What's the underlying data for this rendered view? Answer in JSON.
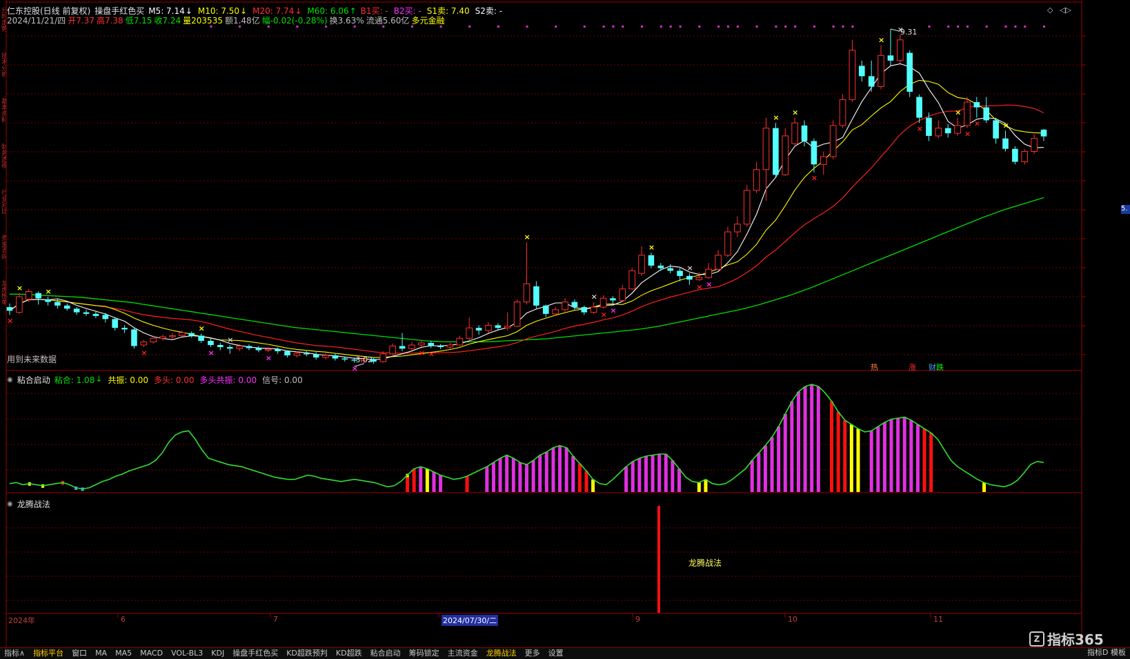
{
  "header": {
    "stock_title": "仁东控股(日线 前复权)",
    "indicator_name": "操盘手红色买",
    "ma": [
      {
        "label": "M5: 7.14",
        "arrow": "↓",
        "color": "#ffffff"
      },
      {
        "label": "M10: 7.50",
        "arrow": "↓",
        "color": "#ffff00"
      },
      {
        "label": "M20: 7.74",
        "arrow": "↓",
        "color": "#ff3030"
      },
      {
        "label": "M60: 6.06",
        "arrow": "↑",
        "color": "#00e000"
      }
    ],
    "signals": [
      {
        "label": "B1买: -",
        "color": "#ff3030"
      },
      {
        "label": "B2买: -",
        "color": "#ff30ff"
      },
      {
        "label": "S1卖: 7.40",
        "color": "#ffff00"
      },
      {
        "label": "S2卖: -",
        "color": "#ffffff"
      }
    ],
    "info": [
      {
        "label": "2024/11/21/四",
        "color": "#c0c0c0"
      },
      {
        "label": "开7.37",
        "color": "#ff3030"
      },
      {
        "label": "高7.38",
        "color": "#ff3030"
      },
      {
        "label": "低7.15",
        "color": "#00e000"
      },
      {
        "label": "收7.24",
        "color": "#00e000"
      },
      {
        "label": "量203535",
        "color": "#ffff00"
      },
      {
        "label": "额1.48亿",
        "color": "#c0c0c0"
      },
      {
        "label": "幅-0.02(-0.28%)",
        "color": "#00e000"
      },
      {
        "label": "换3.63%",
        "color": "#c0c0c0"
      },
      {
        "label": "流通5.60亿",
        "color": "#c0c0c0"
      },
      {
        "label": "多元金融",
        "color": "#ffff00"
      }
    ]
  },
  "main_chart": {
    "future_data_note": "用到未来数据",
    "high_label": "9.31",
    "low_label": "3.02",
    "right_price_badge": "5.",
    "bottom_tags": [
      {
        "label": "热",
        "color": "#ff8040"
      },
      {
        "label": "涨",
        "color": "#ff3030"
      },
      {
        "label": "财",
        "color": "#40a0ff"
      },
      {
        "label": "跌",
        "color": "#00ff00"
      }
    ]
  },
  "panel2": {
    "title": "粘合启动",
    "items": [
      {
        "label": "粘合: 1.08",
        "arrow": "↓",
        "color": "#00e000"
      },
      {
        "label": "共振: 0.00",
        "color": "#ffff00"
      },
      {
        "label": "多头: 0.00",
        "color": "#ff3030"
      },
      {
        "label": "多头共振: 0.00",
        "color": "#ff30ff"
      },
      {
        "label": "信号: 0.00",
        "color": "#c0c0c0"
      }
    ]
  },
  "panel3": {
    "title": "龙腾战法",
    "signal_label": "龙腾战法"
  },
  "time_axis": [
    {
      "label": "2024年",
      "highlight": false
    },
    {
      "label": "6",
      "highlight": false
    },
    {
      "label": "7",
      "highlight": false
    },
    {
      "label": "2024/07/30/二",
      "highlight": true
    },
    {
      "label": "9",
      "highlight": false
    },
    {
      "label": "10",
      "highlight": false
    },
    {
      "label": "11",
      "highlight": false
    }
  ],
  "watermark": "指标365",
  "bottom_tabs": [
    {
      "label": "指标∧",
      "active": false
    },
    {
      "label": "指标平台",
      "active": true
    },
    {
      "label": "窗口",
      "active": false
    },
    {
      "label": "MA",
      "active": false
    },
    {
      "label": "MA5",
      "active": false
    },
    {
      "label": "MACD",
      "active": false
    },
    {
      "label": "VOL-BL3",
      "active": false
    },
    {
      "label": "KDJ",
      "active": false
    },
    {
      "label": "操盘手红色买",
      "active": false
    },
    {
      "label": "KD超跌预判",
      "active": false
    },
    {
      "label": "KD超跌",
      "active": false
    },
    {
      "label": "粘合启动",
      "active": false
    },
    {
      "label": "筹码锁定",
      "active": false
    },
    {
      "label": "主流资金",
      "active": false
    },
    {
      "label": "龙腾战法",
      "active": true
    },
    {
      "label": "更多",
      "active": false
    },
    {
      "label": "设置",
      "active": false
    }
  ],
  "bottom_right": "指标D 模板",
  "left_tabs": [
    "分时走势",
    "技术分析",
    "基本资料",
    "财务透视",
    "行业对比",
    "资金流向",
    "龙虎榜单"
  ],
  "colors": {
    "up": "#ff3030",
    "down": "#54ffff",
    "ma5": "#ffffff",
    "ma10": "#ffff00",
    "ma20": "#ff2020",
    "ma60": "#00e000",
    "grid": "#7a0000",
    "border": "#a00000"
  },
  "chart_data": {
    "type": "candlestick",
    "candles": [
      [
        3.95,
        3.88,
        4.02,
        3.8
      ],
      [
        3.85,
        4.15,
        4.22,
        3.82
      ],
      [
        4.1,
        4.25,
        4.3,
        4.05
      ],
      [
        4.22,
        4.12,
        4.25,
        4.0
      ],
      [
        4.1,
        4.05,
        4.15,
        3.98
      ],
      [
        4.05,
        3.98,
        4.1,
        3.92
      ],
      [
        3.98,
        3.92,
        4.02,
        3.88
      ],
      [
        3.92,
        3.85,
        3.95,
        3.8
      ],
      [
        3.85,
        3.82,
        3.9,
        3.78
      ],
      [
        3.82,
        3.78,
        3.86,
        3.74
      ],
      [
        3.8,
        3.72,
        3.84,
        3.65
      ],
      [
        3.72,
        3.55,
        3.76,
        3.5
      ],
      [
        3.55,
        3.52,
        3.6,
        3.45
      ],
      [
        3.52,
        3.2,
        3.55,
        3.15
      ],
      [
        3.22,
        3.28,
        3.32,
        3.18
      ],
      [
        3.28,
        3.35,
        3.4,
        3.25
      ],
      [
        3.35,
        3.38,
        3.42,
        3.3
      ],
      [
        3.38,
        3.4,
        3.45,
        3.34
      ],
      [
        3.4,
        3.46,
        3.5,
        3.38
      ],
      [
        3.45,
        3.4,
        3.48,
        3.36
      ],
      [
        3.4,
        3.3,
        3.44,
        3.26
      ],
      [
        3.3,
        3.22,
        3.34,
        3.18
      ],
      [
        3.22,
        3.18,
        3.26,
        3.12
      ],
      [
        3.18,
        3.15,
        3.22,
        3.05
      ],
      [
        3.15,
        3.2,
        3.24,
        3.1
      ],
      [
        3.2,
        3.16,
        3.23,
        3.12
      ],
      [
        3.16,
        3.12,
        3.2,
        3.08
      ],
      [
        3.12,
        3.14,
        3.18,
        3.08
      ],
      [
        3.14,
        3.1,
        3.17,
        3.05
      ],
      [
        3.1,
        3.02,
        3.12,
        2.98
      ],
      [
        3.02,
        3.06,
        3.1,
        2.98
      ],
      [
        3.06,
        3.04,
        3.1,
        3.0
      ],
      [
        3.04,
        2.98,
        3.08,
        2.94
      ],
      [
        2.98,
        3.02,
        3.06,
        2.94
      ],
      [
        3.02,
        2.96,
        3.05,
        2.92
      ],
      [
        2.96,
        2.94,
        3.0,
        2.9
      ],
      [
        2.94,
        2.92,
        2.98,
        2.88
      ],
      [
        2.92,
        2.95,
        2.98,
        2.86
      ],
      [
        2.95,
        2.9,
        2.97,
        2.86
      ],
      [
        2.9,
        3.05,
        3.1,
        2.88
      ],
      [
        3.05,
        3.2,
        3.25,
        3.0
      ],
      [
        3.2,
        3.15,
        3.45,
        3.1
      ],
      [
        3.15,
        3.22,
        3.28,
        3.12
      ],
      [
        3.22,
        3.26,
        3.3,
        3.18
      ],
      [
        3.26,
        3.2,
        3.3,
        3.16
      ],
      [
        3.2,
        3.18,
        3.24,
        3.14
      ],
      [
        3.18,
        3.22,
        3.26,
        3.14
      ],
      [
        3.22,
        3.35,
        3.4,
        3.2
      ],
      [
        3.35,
        3.55,
        3.75,
        3.3
      ],
      [
        3.55,
        3.5,
        3.6,
        3.42
      ],
      [
        3.5,
        3.6,
        3.66,
        3.45
      ],
      [
        3.6,
        3.55,
        3.64,
        3.5
      ],
      [
        3.55,
        3.58,
        3.85,
        3.5
      ],
      [
        3.58,
        4.05,
        4.1,
        3.56
      ],
      [
        4.05,
        4.4,
        5.2,
        4.0
      ],
      [
        4.35,
        3.98,
        4.45,
        3.92
      ],
      [
        3.98,
        3.82,
        4.0,
        3.76
      ],
      [
        3.82,
        3.9,
        3.96,
        3.78
      ],
      [
        3.9,
        4.05,
        4.12,
        3.86
      ],
      [
        4.05,
        3.95,
        4.1,
        3.9
      ],
      [
        3.95,
        3.85,
        3.98,
        3.8
      ],
      [
        3.85,
        3.95,
        4.05,
        3.82
      ],
      [
        3.95,
        4.12,
        4.18,
        3.92
      ],
      [
        4.12,
        4.08,
        4.16,
        4.0
      ],
      [
        4.08,
        4.3,
        4.38,
        4.05
      ],
      [
        4.3,
        4.65,
        4.7,
        4.28
      ],
      [
        4.6,
        4.95,
        5.12,
        4.55
      ],
      [
        4.95,
        4.75,
        5.0,
        4.7
      ],
      [
        4.75,
        4.7,
        4.8,
        4.65
      ],
      [
        4.7,
        4.65,
        4.78,
        4.6
      ],
      [
        4.65,
        4.55,
        4.7,
        4.45
      ],
      [
        4.55,
        4.48,
        4.6,
        4.38
      ],
      [
        4.48,
        4.52,
        4.62,
        4.45
      ],
      [
        4.52,
        4.68,
        4.8,
        4.5
      ],
      [
        4.68,
        4.95,
        5.05,
        4.65
      ],
      [
        4.95,
        5.4,
        5.5,
        4.92
      ],
      [
        5.4,
        5.55,
        5.7,
        5.3
      ],
      [
        5.55,
        6.2,
        6.3,
        5.5
      ],
      [
        6.2,
        6.6,
        6.75,
        6.15
      ],
      [
        6.6,
        7.4,
        7.6,
        6.0
      ],
      [
        7.4,
        6.5,
        7.5,
        6.45
      ],
      [
        6.5,
        7.25,
        7.4,
        6.48
      ],
      [
        7.1,
        7.5,
        7.6,
        7.05
      ],
      [
        7.45,
        7.15,
        7.55,
        7.05
      ],
      [
        7.15,
        6.7,
        7.2,
        6.55
      ],
      [
        6.7,
        6.85,
        6.95,
        6.5
      ],
      [
        6.85,
        7.45,
        7.55,
        6.8
      ],
      [
        7.45,
        7.95,
        8.05,
        7.4
      ],
      [
        7.95,
        8.9,
        9.1,
        7.9
      ],
      [
        8.6,
        8.4,
        8.7,
        8.3
      ],
      [
        8.4,
        8.2,
        8.7,
        8.1
      ],
      [
        8.2,
        8.8,
        9.0,
        8.15
      ],
      [
        8.8,
        8.7,
        9.31,
        8.6
      ],
      [
        8.7,
        9.1,
        9.2,
        8.65
      ],
      [
        8.85,
        8.1,
        8.9,
        8.0
      ],
      [
        8.0,
        7.6,
        8.05,
        7.5
      ],
      [
        7.6,
        7.25,
        7.7,
        7.15
      ],
      [
        7.25,
        7.4,
        7.55,
        7.2
      ],
      [
        7.4,
        7.3,
        7.48,
        7.22
      ],
      [
        7.3,
        7.45,
        7.6,
        7.25
      ],
      [
        7.45,
        7.9,
        8.0,
        7.4
      ],
      [
        7.9,
        7.8,
        8.0,
        7.6
      ],
      [
        7.8,
        7.55,
        8.0,
        7.5
      ],
      [
        7.55,
        7.2,
        7.6,
        7.1
      ],
      [
        7.2,
        7.0,
        7.35,
        6.95
      ],
      [
        7.0,
        6.75,
        7.05,
        6.7
      ],
      [
        6.75,
        6.95,
        7.0,
        6.7
      ],
      [
        6.95,
        7.2,
        7.28,
        6.9
      ],
      [
        7.37,
        7.24,
        7.38,
        7.15
      ]
    ],
    "ma60": [
      4.2,
      4.2,
      4.19,
      4.18,
      4.17,
      4.16,
      4.15,
      4.14,
      4.12,
      4.1,
      4.08,
      4.06,
      4.04,
      4.01,
      3.98,
      3.95,
      3.92,
      3.89,
      3.86,
      3.83,
      3.8,
      3.77,
      3.74,
      3.71,
      3.68,
      3.65,
      3.62,
      3.59,
      3.56,
      3.54,
      3.52,
      3.5,
      3.48,
      3.46,
      3.44,
      3.42,
      3.4,
      3.38,
      3.36,
      3.34,
      3.32,
      3.3,
      3.29,
      3.28,
      3.28,
      3.28,
      3.28,
      3.28,
      3.29,
      3.3,
      3.31,
      3.32,
      3.33,
      3.34,
      3.36,
      3.38,
      3.4,
      3.42,
      3.44,
      3.46,
      3.48,
      3.5,
      3.52,
      3.55,
      3.58,
      3.62,
      3.66,
      3.7,
      3.74,
      3.78,
      3.82,
      3.86,
      3.9,
      3.95,
      4.0,
      4.06,
      4.12,
      4.18,
      4.25,
      4.32,
      4.4,
      4.48,
      4.56,
      4.64,
      4.72,
      4.8,
      4.88,
      4.96,
      5.04,
      5.12,
      5.2,
      5.28,
      5.36,
      5.44,
      5.52,
      5.6,
      5.68,
      5.75,
      5.82,
      5.88,
      5.94,
      6.0,
      6.06
    ],
    "osc": [
      0.06,
      0.07,
      0.05,
      0.06,
      0.05,
      0.04,
      0.05,
      0.06,
      0.07,
      0.05,
      0.02,
      0.01,
      0.02,
      0.05,
      0.08,
      0.1,
      0.13,
      0.15,
      0.18,
      0.2,
      0.22,
      0.24,
      0.28,
      0.35,
      0.45,
      0.52,
      0.55,
      0.56,
      0.48,
      0.38,
      0.3,
      0.28,
      0.26,
      0.24,
      0.23,
      0.22,
      0.2,
      0.18,
      0.16,
      0.14,
      0.12,
      0.11,
      0.1,
      0.1,
      0.12,
      0.14,
      0.13,
      0.11,
      0.1,
      0.09,
      0.08,
      0.09,
      0.1,
      0.09,
      0.08,
      0.07,
      0.05,
      0.03,
      0.04,
      0.08,
      0.14,
      0.2,
      0.22,
      0.2,
      0.17,
      0.14,
      0.12,
      0.1,
      0.11,
      0.13,
      0.16,
      0.19,
      0.22,
      0.26,
      0.3,
      0.33,
      0.3,
      0.26,
      0.24,
      0.28,
      0.33,
      0.36,
      0.4,
      0.42,
      0.4,
      0.32,
      0.25,
      0.18,
      0.1,
      0.06,
      0.05,
      0.1,
      0.16,
      0.22,
      0.27,
      0.3,
      0.32,
      0.33,
      0.34,
      0.34,
      0.28,
      0.2,
      0.12,
      0.08,
      0.07,
      0.1,
      0.06,
      0.05,
      0.06,
      0.1,
      0.15,
      0.2,
      0.28,
      0.35,
      0.42,
      0.5,
      0.6,
      0.72,
      0.84,
      0.93,
      0.98,
      1.0,
      0.98,
      0.92,
      0.84,
      0.74,
      0.66,
      0.62,
      0.58,
      0.55,
      0.56,
      0.6,
      0.64,
      0.67,
      0.68,
      0.69,
      0.66,
      0.62,
      0.58,
      0.54,
      0.48,
      0.38,
      0.28,
      0.22,
      0.18,
      0.14,
      0.1,
      0.07,
      0.05,
      0.04,
      0.03,
      0.05,
      0.09,
      0.16,
      0.24,
      0.27,
      0.26
    ]
  }
}
